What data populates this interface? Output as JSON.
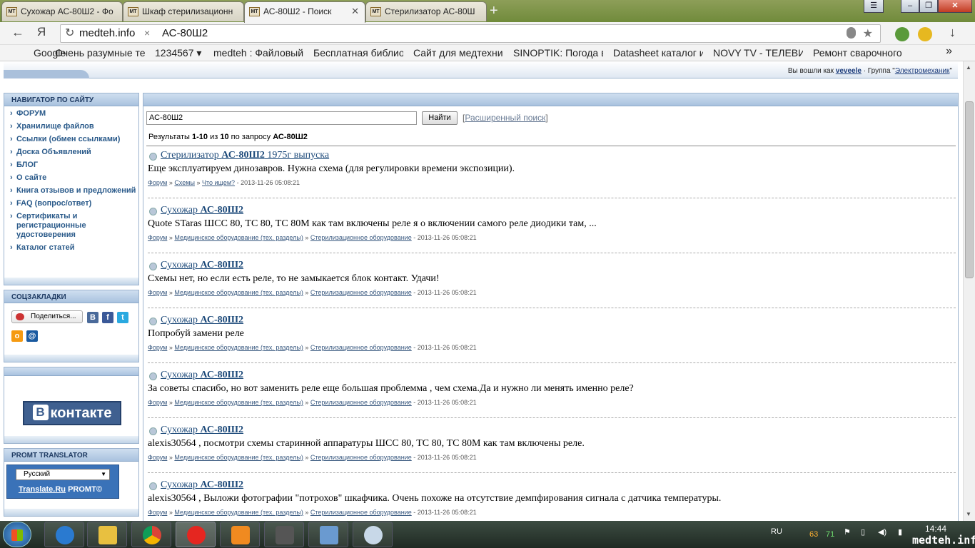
{
  "browser": {
    "tabs": [
      {
        "title": "Сухожар АС-80Ш2 - Фо",
        "active": false
      },
      {
        "title": "Шкаф стерилизационн",
        "active": false
      },
      {
        "title": "АС-80Ш2 - Поиск",
        "active": true
      },
      {
        "title": "Стерилизатор АС-80Ш",
        "active": false
      }
    ],
    "tab_favicon": "MT",
    "new_tab": "+",
    "window_buttons": {
      "menu": "☰",
      "minimize": "–",
      "restore": "❐",
      "close": "✕"
    },
    "back": "←",
    "yandex_logo": "Я",
    "address": {
      "domain": "medteh.info",
      "query": "АС-80Ш2",
      "clear": "×"
    },
    "download": "↓",
    "bookmarks": [
      "Google",
      "Очень разумные те",
      "1234567 ▾",
      "medteh : Файловый",
      "Бесплатная библио",
      "Сайт для медтехник",
      "SINOPTIK: Погода в",
      "Datasheet каталог и",
      "NOVY TV - ТЕЛЕВИД",
      "Ремонт сварочного"
    ],
    "bookmarks_more": "»"
  },
  "page": {
    "login": {
      "prefix": "Вы вошли как",
      "user": "veveele",
      "group_prefix": "· Группа \"",
      "group": "Электромеханик",
      "group_suffix": "\""
    },
    "nav": {
      "title": "НАВИГАТОР ПО САЙТУ",
      "items": [
        "ФОРУМ",
        "Хранилище файлов",
        "Ссылки (обмен ссылками)",
        "Доска Объявлений",
        "БЛОГ",
        "О сайте",
        "Книга отзывов и предложений",
        "FAQ (вопрос/ответ)",
        "Сертификаты и регистрационные удостоверения",
        "Каталог статей"
      ]
    },
    "social": {
      "title": "СОЦЗАКЛАДКИ",
      "share_label": "Поделиться...",
      "icons": [
        "vk-icon",
        "facebook-icon",
        "twitter-icon",
        "odnoklassniki-icon",
        "mailru-icon"
      ]
    },
    "vk_banner": {
      "letter": "В",
      "text": "контакте"
    },
    "promt": {
      "title": "PROMT TRANSLATOR",
      "language": "Русский",
      "brand_link": "Translate.Ru",
      "brand": "PROMT©"
    },
    "search": {
      "value": "АС-80Ш2",
      "button": "Найти",
      "advanced_open": "[",
      "advanced": "Расширенный поиск",
      "advanced_close": "]",
      "summary": {
        "prefix": "Результаты",
        "range": "1-10",
        "of": "из",
        "total": "10",
        "by_query": "по запросу",
        "query": "АС-80Ш2"
      }
    },
    "results": [
      {
        "title_before": "Стерилизатор ",
        "title_bold": "АС-80Ш2",
        "title_after": " 1975г выпуска",
        "snippet": "Еще эксплуатируем динозавров. Нужна схема (для регулировки времени экспозиции).",
        "crumbs": [
          "Форум",
          "Схемы",
          "Что ищем?"
        ],
        "date": "2013-11-26 05:08:21"
      },
      {
        "title_before": "Сухожар ",
        "title_bold": "АС-80Ш2",
        "title_after": "",
        "snippet": "Quote STaras ШСС 80, ТС 80, ТС 80М как там включены реле я о включении самого реле диодики там, ...",
        "crumbs": [
          "Форум",
          "Медицинское оборудование (тех. разделы)",
          "Стерилизационное оборудование"
        ],
        "date": "2013-11-26 05:08:21"
      },
      {
        "title_before": "Сухожар ",
        "title_bold": "АС-80Ш2",
        "title_after": "",
        "snippet": "Схемы нет, но если есть реле, то не замыкается блок контакт. Удачи!",
        "crumbs": [
          "Форум",
          "Медицинское оборудование (тех. разделы)",
          "Стерилизационное оборудование"
        ],
        "date": "2013-11-26 05:08:21"
      },
      {
        "title_before": "Сухожар ",
        "title_bold": "АС-80Ш2",
        "title_after": "",
        "snippet": "Попробуй замени реле",
        "crumbs": [
          "Форум",
          "Медицинское оборудование (тех. разделы)",
          "Стерилизационное оборудование"
        ],
        "date": "2013-11-26 05:08:21"
      },
      {
        "title_before": "Сухожар ",
        "title_bold": "АС-80Ш2",
        "title_after": "",
        "snippet": "За советы спасибо, но вот заменить реле еще большая проблемма , чем схема.Да и нужно ли менять именно реле?",
        "crumbs": [
          "Форум",
          "Медицинское оборудование (тех. разделы)",
          "Стерилизационное оборудование"
        ],
        "date": "2013-11-26 05:08:21"
      },
      {
        "title_before": "Сухожар ",
        "title_bold": "АС-80Ш2",
        "title_after": "",
        "snippet": "alexis30564 , посмотри схемы старинной аппаратуры ШСС 80, ТС 80, ТС 80М как там включены реле.",
        "crumbs": [
          "Форум",
          "Медицинское оборудование (тех. разделы)",
          "Стерилизационное оборудование"
        ],
        "date": "2013-11-26 05:08:21"
      },
      {
        "title_before": "Сухожар ",
        "title_bold": "АС-80Ш2",
        "title_after": "",
        "snippet": "alexis30564 , Выложи фотографии \"потрохов\" шкафчика. Очень похоже на отсутствие демпфирования сигнала с датчика температуры.",
        "crumbs": [
          "Форум",
          "Медицинское оборудование (тех. разделы)",
          "Стерилизационное оборудование"
        ],
        "date": "2013-11-26 05:08:21"
      }
    ],
    "crumb_sep": "»",
    "date_sep": "-"
  },
  "taskbar": {
    "apps": [
      "internet-explorer-icon",
      "file-explorer-icon",
      "chrome-icon",
      "yandex-browser-icon",
      "media-player-icon",
      "world-of-tanks-icon",
      "image-viewer-icon",
      "paint-icon"
    ],
    "language": "RU",
    "tray_numbers": [
      "63",
      "71"
    ],
    "time": "14:44",
    "watermark": "medteh.info"
  },
  "colors": {
    "link": "#1d4a7a",
    "nav_link": "#2a5a8a",
    "block_header": "#a9c2df",
    "taskbar": "#1f2a23"
  }
}
